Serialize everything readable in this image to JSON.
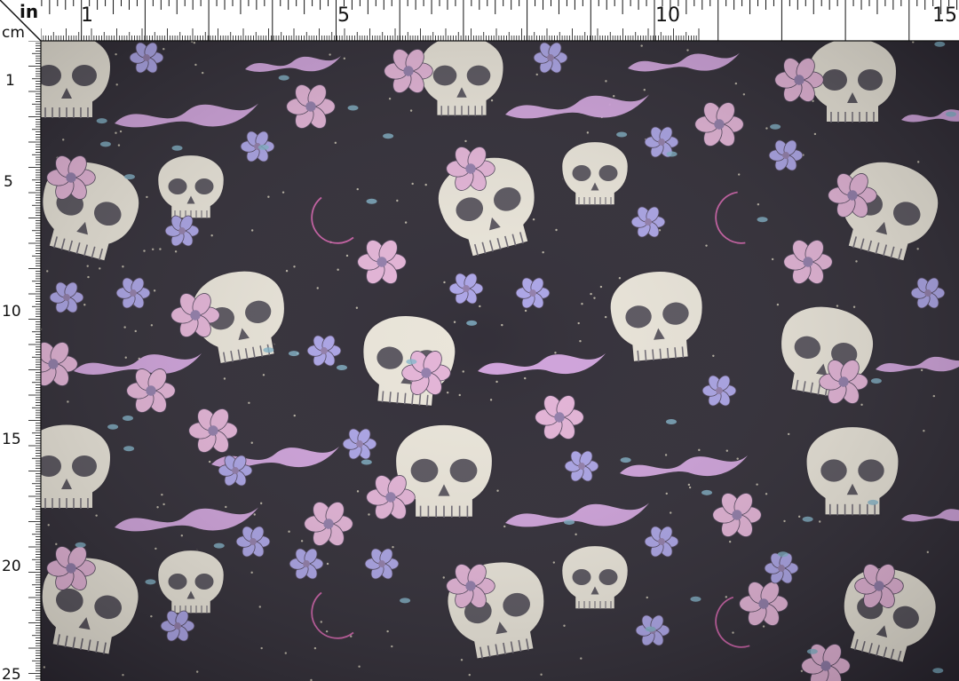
{
  "ruler": {
    "corner_top": "in",
    "corner_bottom": "cm",
    "inch_labels": [
      "1",
      "5",
      "10",
      "15"
    ],
    "cm_labels": [
      "1",
      "5",
      "10",
      "15",
      "20",
      "25"
    ]
  },
  "fabric": {
    "colors": {
      "background": "#2b2731",
      "skull": "#e9e4d8",
      "skull_shadow": "#55515a",
      "pink_flower": "#e3b2d6",
      "violet_flower": "#a9a2e6",
      "smoke": "#d7a6e4",
      "leaf": "#7fb3c9",
      "star": "#f1ead0"
    },
    "icons": [
      "skull-icon",
      "flower-icon",
      "moon-icon",
      "smoke-icon",
      "star-icon"
    ]
  }
}
